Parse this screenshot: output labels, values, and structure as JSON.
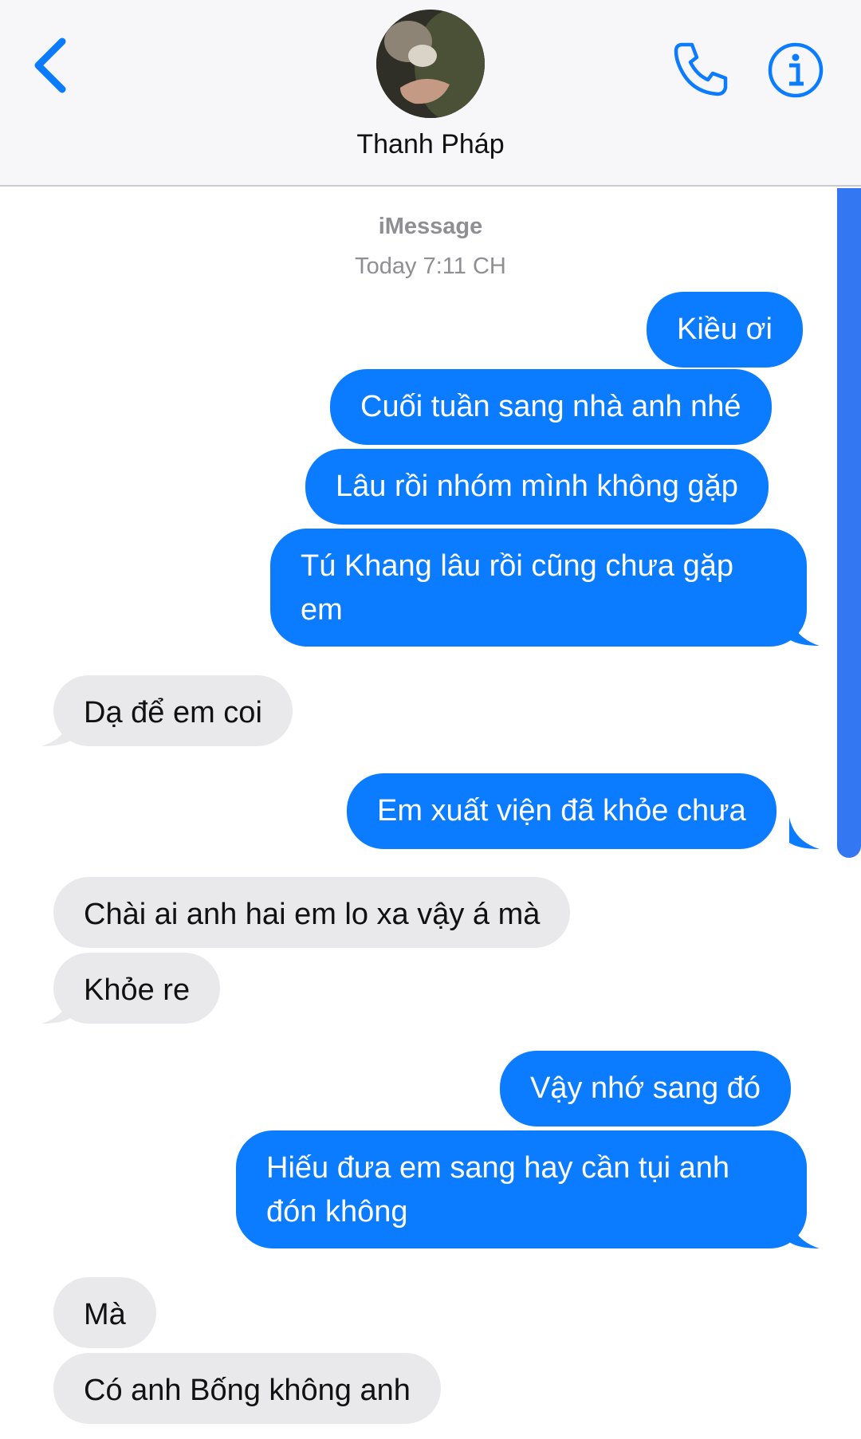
{
  "header": {
    "contact_name": "Thanh Pháp",
    "back_icon": "chevron-left-icon",
    "call_icon": "phone-icon",
    "info_icon": "info-icon",
    "accent_color": "#0b7bff"
  },
  "conversation": {
    "service": "iMessage",
    "timestamp": "Today 7:11 CH",
    "messages": [
      {
        "from": "me",
        "text": "Kiều ơi"
      },
      {
        "from": "me",
        "text": "Cuối tuần sang nhà anh nhé"
      },
      {
        "from": "me",
        "text": "Lâu rồi nhóm mình không gặp"
      },
      {
        "from": "me",
        "text": "Tú Khang lâu rồi cũng chưa gặp em"
      },
      {
        "from": "them",
        "text": "Dạ để em coi"
      },
      {
        "from": "me",
        "text": "Em xuất viện đã khỏe chưa"
      },
      {
        "from": "them",
        "text": "Chài ai anh hai em lo xa vậy á mà"
      },
      {
        "from": "them",
        "text": "Khỏe re"
      },
      {
        "from": "me",
        "text": "Vậy nhớ sang đó"
      },
      {
        "from": "me",
        "text": "Hiếu đưa em sang hay cần tụi anh đón không"
      },
      {
        "from": "them",
        "text": "Mà"
      },
      {
        "from": "them",
        "text": "Có anh Bống không anh"
      }
    ]
  },
  "colors": {
    "sent_bubble": "#0b7bff",
    "received_bubble": "#e9e9eb"
  }
}
